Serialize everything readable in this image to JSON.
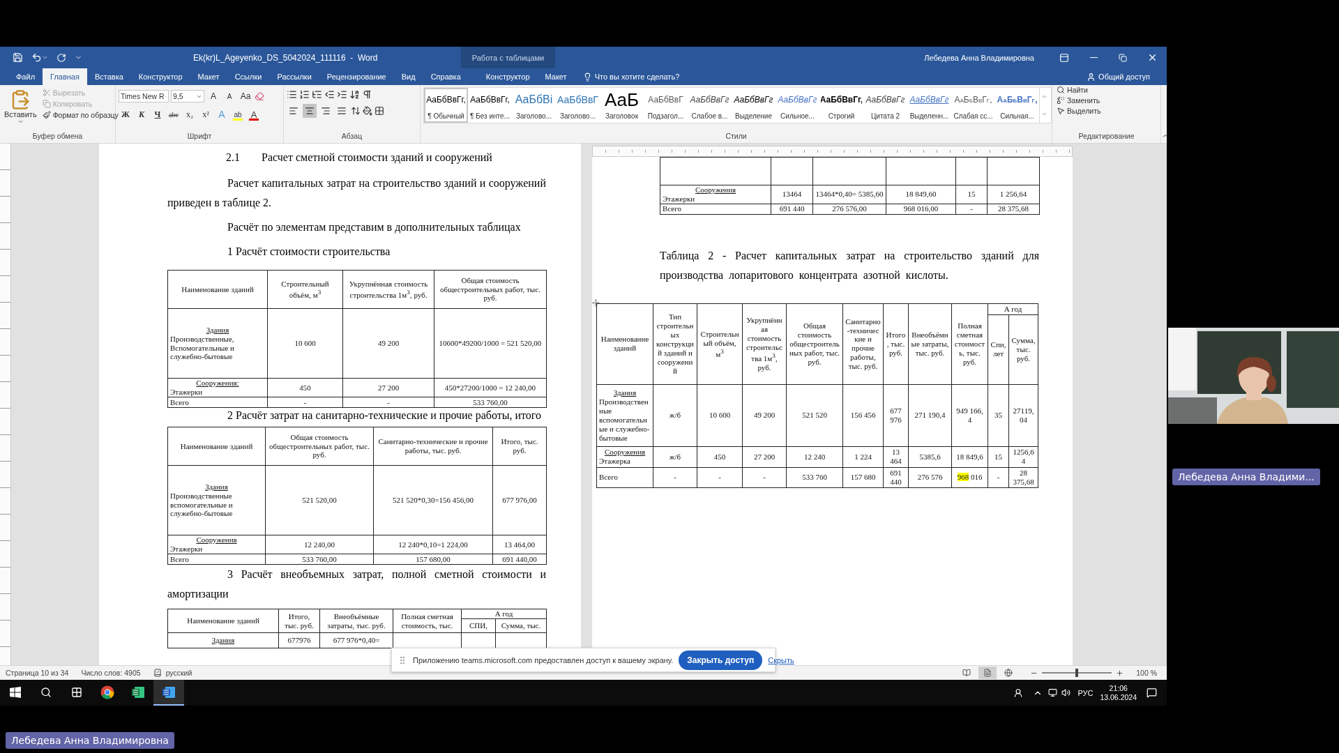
{
  "window": {
    "title": "Ek(kr)L_Ageyenko_DS_5042024_111116  -  Word",
    "context_group": "Работа с таблицами",
    "user": "Лебедева Анна Владимировна"
  },
  "tabs": [
    {
      "label": "Файл",
      "selected": false
    },
    {
      "label": "Главная",
      "selected": true
    },
    {
      "label": "Вставка",
      "selected": false
    },
    {
      "label": "Конструктор",
      "selected": false
    },
    {
      "label": "Макет",
      "selected": false
    },
    {
      "label": "Ссылки",
      "selected": false
    },
    {
      "label": "Рассылки",
      "selected": false
    },
    {
      "label": "Рецензирование",
      "selected": false
    },
    {
      "label": "Вид",
      "selected": false
    },
    {
      "label": "Справка",
      "selected": false
    },
    {
      "label": "Конструктор",
      "selected": false
    },
    {
      "label": "Макет",
      "selected": false
    }
  ],
  "tell_me": "Что вы хотите сделать?",
  "share": "Общий доступ",
  "ribbon": {
    "clipboard": {
      "paste": "Вставить",
      "items": [
        {
          "kind": "cut",
          "label": "Вырезать",
          "disabled": true
        },
        {
          "kind": "copy",
          "label": "Копировать",
          "disabled": true
        },
        {
          "kind": "painter",
          "label": "Формат по образцу",
          "disabled": false
        }
      ],
      "label": "Буфер обмена"
    },
    "font": {
      "name": "Times New R",
      "size": "9,5",
      "row1": [
        {
          "kind": "grow",
          "label": "A"
        },
        {
          "kind": "shrink",
          "label": "A"
        },
        {
          "kind": "case",
          "label": "Aa"
        }
      ],
      "row2": [
        {
          "kind": "bold",
          "label": "Ж"
        },
        {
          "kind": "italic",
          "label": "К"
        },
        {
          "kind": "underline",
          "label": "Ч"
        },
        {
          "kind": "strike",
          "label": "abc"
        },
        {
          "kind": "sub",
          "label": "x₂"
        },
        {
          "kind": "sup",
          "label": "x²"
        },
        {
          "kind": "effects",
          "label": "A"
        },
        {
          "kind": "highlight",
          "label": "ab"
        },
        {
          "kind": "color",
          "label": "A"
        }
      ],
      "label": "Шрифт"
    },
    "paragraph": {
      "align": [
        {
          "selected": false
        },
        {
          "selected": true
        },
        {
          "selected": false
        },
        {
          "selected": false
        }
      ],
      "label": "Абзац"
    },
    "styles": {
      "items": [
        {
          "sample": "АаБбВвГг,",
          "name": "¶ Обычный",
          "kind": "normal",
          "selected": true
        },
        {
          "sample": "АаБбВвГг,",
          "name": "¶ Без инте...",
          "kind": "normal",
          "selected": false
        },
        {
          "sample": "АаБбВі",
          "name": "Заголово...",
          "kind": "heading1",
          "selected": false
        },
        {
          "sample": "АаБбВвГ",
          "name": "Заголово...",
          "kind": "heading2",
          "selected": false
        },
        {
          "sample": "АаБ",
          "name": "Заголовок",
          "kind": "title",
          "selected": false
        },
        {
          "sample": "АаБбВвГ",
          "name": "Подзагол...",
          "kind": "subtitle",
          "selected": false
        },
        {
          "sample": "АаБбВвГг",
          "name": "Слабое в...",
          "kind": "subtle",
          "selected": false
        },
        {
          "sample": "АаБбВвГг",
          "name": "Выделение",
          "kind": "emphasis",
          "selected": false
        },
        {
          "sample": "АаБбВвГг",
          "name": "Сильное...",
          "kind": "intense",
          "selected": false
        },
        {
          "sample": "АаБбВвГг,",
          "name": "Строгий",
          "kind": "strong",
          "selected": false
        },
        {
          "sample": "АаБбВвГг",
          "name": "Цитата 2",
          "kind": "quote",
          "selected": false
        },
        {
          "sample": "АаБбВвГг",
          "name": "Выделенн...",
          "kind": "intensequote",
          "selected": false
        },
        {
          "sample": "АаБбВвГг,",
          "name": "Слабая сс...",
          "kind": "subtleref",
          "selected": false
        },
        {
          "sample": "АаБбВвГг,",
          "name": "Сильная...",
          "kind": "intenseref",
          "selected": false
        }
      ],
      "label": "Стили"
    },
    "editing": {
      "items": [
        {
          "kind": "find",
          "label": "Найти"
        },
        {
          "kind": "replace",
          "label": "Заменить"
        },
        {
          "kind": "select",
          "label": "Выделить"
        }
      ],
      "label": "Редактирование"
    }
  },
  "pages": [
    {
      "blocks": [
        {
          "kind": "heading",
          "number": "2.1",
          "text": "Расчет сметной стоимости зданий и сооружений"
        },
        {
          "kind": "paragraph",
          "text": "Расчет капитальных затрат на строительство зданий и сооружений приведен в таблице 2."
        },
        {
          "kind": "paragraph",
          "text": "Расчёт по элементам представим в дополнительных таблицах"
        },
        {
          "kind": "paragraph",
          "text": "1 Расчёт стоимости строительства"
        },
        {
          "kind": "table",
          "columns": [
            "Наименование зданий",
            "Строительный объём, м$^{3}$",
            "Укрупнённая стоимость строительства 1м$^{3}$, руб.",
            "Общая стоимость общестроительных работ, тыс. руб."
          ],
          "rows": [
            {
              "kind": "data",
              "cells": [
                {
                  "lead": "Здания",
                  "text": "Производственные, Вспомогательные и служебно-бытовые"
                },
                "10 600",
                "49 200",
                "10600*49200/1000 = 521 520,00"
              ]
            },
            {
              "kind": "data",
              "cells": [
                {
                  "lead": "Сооружения:",
                  "text": "Этажерки"
                },
                "450",
                "27 200",
                "450*27200/1000 = 12 240,00"
              ]
            },
            {
              "kind": "data",
              "cells": [
                "Всего",
                "-",
                "-",
                "533  760,00"
              ]
            }
          ]
        },
        {
          "kind": "subheading",
          "text": "2 Расчёт затрат на санитарно-технические и прочие работы, итого"
        },
        {
          "kind": "table",
          "columns": [
            "Наименование зданий",
            "Общая стоимость общестроительных работ, тыс. руб.",
            "Санитарно-технические и прочие работы, тыс. руб.",
            "Итого, тыс. руб."
          ],
          "rows": [
            {
              "kind": "data",
              "cells": [
                {
                  "lead": "Здания",
                  "text": "Производственные вспомогательные и служебно-бытовые"
                },
                "521 520,00",
                "521 520*0,30=156 456,00",
                "677 976,00"
              ]
            },
            {
              "kind": "data",
              "cells": [
                {
                  "lead": "Сооружения",
                  "text": "Этажерки"
                },
                "12 240,00",
                "12 240*0,10=1 224,00",
                "13 464,00"
              ]
            },
            {
              "kind": "data",
              "cells": [
                "Всего",
                "533 760,00",
                "157 680,00",
                "691 440,00"
              ]
            }
          ]
        },
        {
          "kind": "paragraph",
          "text": "3  Расчёт внеобъемных затрат, полной сметной стоимости и амортизации"
        },
        {
          "kind": "table",
          "columns": [
            "Наименование зданий",
            "Итого, тыс. руб.",
            "Внеобъёмные затраты, тыс. руб.",
            "Полная сметная стоимость, тыс.",
            {
              "label": "А год",
              "colspan": 2,
              "children": [
                "СПИ,",
                "Сумма, тыс."
              ]
            }
          ],
          "rows": [
            {
              "kind": "data",
              "cells": [
                {
                  "lead": "Здания"
                },
                "677976",
                "677 976*0,40="
              ]
            }
          ]
        }
      ]
    },
    {
      "blocks": [
        {
          "kind": "table",
          "rows": [
            {
              "kind": "continued"
            },
            {
              "kind": "data",
              "cells": [
                {
                  "lead": "Сооружения",
                  "text": "Этажерки"
                },
                "13464",
                "13464*0,40= 5385,60",
                "18 849,60",
                "15",
                "1 256,64"
              ]
            },
            {
              "kind": "data",
              "cells": [
                "Всего",
                "691 440",
                "276 576,00",
                "968 016,00",
                "-",
                "28 375,68"
              ]
            }
          ]
        },
        {
          "kind": "caption",
          "text": "Таблица 2 - Расчет капитальных затрат на строительство зданий для производства лопаритового концентрата азотной кислоты."
        },
        {
          "kind": "table",
          "columns": [
            "Наименование зданий",
            "Тип строительных конструкций зданий и сооружений",
            "Строительный объём, м$^{3}$",
            "Укрупнённая стоимость строительства 1м$^{3}$, руб.",
            "Общая стоимость общестроительных работ, тыс. руб.",
            "Санитарно-технические и прочие работы, тыс. руб.",
            "Итого, тыс. руб.",
            "Внеобъёмные затраты, тыс. руб.",
            "Полная сметная стоимость, тыс. руб.",
            {
              "label": "А год",
              "colspan": 2,
              "children": [
                "Спи, лет",
                "Сумма, тыс. руб."
              ]
            }
          ],
          "rows": [
            {
              "kind": "data",
              "cells": [
                {
                  "lead": "Здания",
                  "text": "Производственные вспомогательные и служебно-бытовые"
                },
                "ж/б",
                "10 600",
                "49 200",
                "521 520",
                "156 456",
                "677 976",
                "271 190,4",
                "949 166, 4",
                "35",
                "27119, 04"
              ]
            },
            {
              "kind": "data",
              "cells": [
                {
                  "lead": "Сооружения",
                  "text": "Этажерка"
                },
                "ж/б",
                "450",
                "27 200",
                "12 240",
                "1 224",
                "13 464",
                "5385,6",
                "18 849,6",
                "15",
                "1256,6 4"
              ]
            },
            {
              "kind": "data",
              "cells": [
                "Всего",
                "-",
                "-",
                "-",
                "533 760",
                "157 680",
                "691 440",
                "276 576",
                {
                  "mark": "968",
                  "text": " 016"
                },
                "-",
                "28 375,68"
              ]
            }
          ]
        }
      ]
    }
  ],
  "status_bar": {
    "page": "Страница 10 из 34",
    "words": "Число слов: 4905",
    "language": "русский",
    "views": [
      {
        "kind": "read",
        "selected": false
      },
      {
        "kind": "print",
        "selected": true
      },
      {
        "kind": "web",
        "selected": false
      }
    ],
    "zoom": {
      "level": 0.5,
      "reading": "100 %"
    }
  },
  "share_bar": {
    "message": "Приложению teams.microsoft.com предоставлен доступ к вашему экрану.",
    "stop": "Закрыть доступ",
    "hide": "Скрыть"
  },
  "taskbar": {
    "apps": [
      {
        "kind": "chrome",
        "active": false
      },
      {
        "kind": "excel",
        "active": false
      },
      {
        "kind": "word",
        "active": true
      }
    ],
    "language": "РУС",
    "time": "21:06",
    "date": "13.06.2024"
  },
  "video": {
    "kind": "picture",
    "name": "Лебедева Анна Владими..."
  },
  "presenter": "Лебедева Анна Владимировна"
}
